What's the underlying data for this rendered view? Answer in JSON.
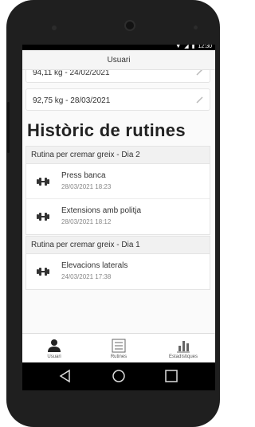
{
  "statusbar": {
    "time": "12:30"
  },
  "appbar": {
    "title": "Usuari"
  },
  "weights": [
    {
      "text": "94,11 kg - 24/02/2021"
    },
    {
      "text": "92,75 kg - 28/03/2021"
    }
  ],
  "section_title": "Històric de rutines",
  "groups": [
    {
      "title": "Rutina per cremar greix - Dia 2",
      "items": [
        {
          "name": "Press banca",
          "date": "28/03/2021 18:23"
        },
        {
          "name": "Extensions amb politja",
          "date": "28/03/2021 18:12"
        }
      ]
    },
    {
      "title": "Rutina per cremar greix - Dia 1",
      "items": [
        {
          "name": "Elevacions laterals",
          "date": "24/03/2021 17:38"
        }
      ]
    }
  ],
  "bottomnav": {
    "items": [
      {
        "label": "Usuari",
        "icon": "person-icon",
        "active": true
      },
      {
        "label": "Rutines",
        "icon": "list-icon",
        "active": false
      },
      {
        "label": "Estadístiques",
        "icon": "bar-chart-icon",
        "active": false
      }
    ]
  },
  "colors": {
    "accent": "#222222",
    "screen_bg": "#fafafa",
    "header_bg": "#f1f1f1"
  }
}
